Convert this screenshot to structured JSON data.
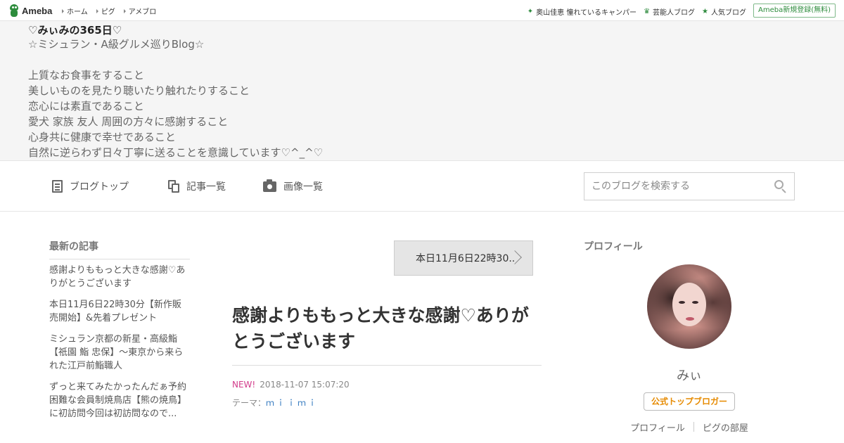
{
  "topbar": {
    "logo_text": "Ameba",
    "nav": [
      "ホーム",
      "ピグ",
      "アメブロ"
    ],
    "links": [
      {
        "icon": "clover-icon",
        "label": "奥山佳恵 憧れているキャンパー"
      },
      {
        "icon": "crown-icon",
        "label": "芸能人ブログ"
      },
      {
        "icon": "star-icon",
        "label": "人気ブログ"
      }
    ],
    "register_label": "Ameba新規登録(無料)"
  },
  "header": {
    "title": "♡みぃみの365日♡",
    "description": "☆ミシュラン・A級グルメ巡りBlog☆\n\n上質なお食事をすること\n美しいものを見たり聴いたり触れたりすること\n恋心には素直であること\n愛犬 家族 友人 周囲の方々に感謝すること\n心身共に健康で幸せであること\n自然に逆らわず日々丁寧に送ることを意識しています♡^_^♡"
  },
  "subnav": {
    "items": [
      "ブログトップ",
      "記事一覧",
      "画像一覧"
    ],
    "search_placeholder": "このブログを検索する"
  },
  "sidebar": {
    "heading": "最新の記事",
    "recent": [
      "感謝よりももっと大きな感謝♡ありがとうございます",
      "本日11月6日22時30分【新作販売開始】&先着プレゼント",
      "ミシュラン京都の新星・高級鮨【祇園 鮨 忠保】〜東京から来られた江戸前鮨職人",
      "ずっと来てみたかったんだぁ予約困難な会員制焼鳥店【熊の焼鳥】に初訪問今回は初訪問なので..."
    ]
  },
  "entry": {
    "next_label": "本日11月6日22時30...",
    "title": "感謝よりももっと大きな感謝♡ありがとうございます",
    "new_badge": "NEW!",
    "datetime": "2018-11-07 15:07:20",
    "theme_prefix": "テーマ：",
    "theme": "ｍｉｉｍｉ"
  },
  "profile": {
    "heading": "プロフィール",
    "name": "みぃ",
    "badge": "公式トップブロガー",
    "links": [
      "プロフィール",
      "ピグの部屋"
    ]
  }
}
